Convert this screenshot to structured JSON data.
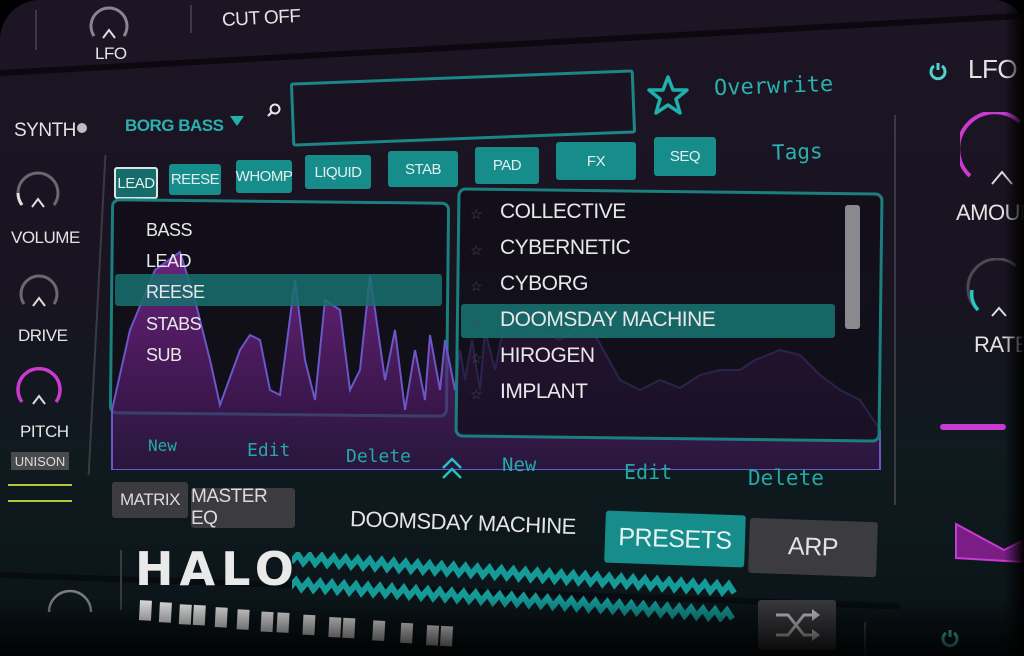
{
  "top": {
    "lfo_knob_label": "LFO",
    "cutoff_label": "CUT OFF"
  },
  "left_panel": {
    "section_label": "SYNTH",
    "knobs": [
      {
        "label": "VOLUME",
        "value": 0.15,
        "color": "#cfcfcf"
      },
      {
        "label": "DRIVE",
        "value": 0.0,
        "color": "#cfcfcf"
      },
      {
        "label": "PITCH",
        "value": 1.0,
        "color": "#c93ad0"
      }
    ],
    "unison_label": "UNISON"
  },
  "browser": {
    "bank_name": "BORG BASS",
    "search": {
      "value": "",
      "placeholder": ""
    },
    "favorite_icon": "star-outline-icon",
    "overwrite_label": "Overwrite",
    "tags_label": "Tags",
    "tags": [
      {
        "label": "LEAD",
        "active": true
      },
      {
        "label": "REESE",
        "active": false
      },
      {
        "label": "WHOMP",
        "active": false
      },
      {
        "label": "LIQUID",
        "active": false
      },
      {
        "label": "STAB",
        "active": false
      },
      {
        "label": "PAD",
        "active": false
      },
      {
        "label": "FX",
        "active": false
      },
      {
        "label": "SEQ",
        "active": false
      }
    ],
    "categories": [
      {
        "label": "BASS",
        "selected": false
      },
      {
        "label": "LEAD",
        "selected": false
      },
      {
        "label": "REESE",
        "selected": true
      },
      {
        "label": "STABS",
        "selected": false
      },
      {
        "label": "SUB",
        "selected": false
      }
    ],
    "presets": [
      {
        "label": "COLLECTIVE",
        "selected": false
      },
      {
        "label": "CYBERNETIC",
        "selected": false
      },
      {
        "label": "CYBORG",
        "selected": false
      },
      {
        "label": "DOOMSDAY MACHINE",
        "selected": true
      },
      {
        "label": "HIROGEN",
        "selected": false
      },
      {
        "label": "IMPLANT",
        "selected": false
      }
    ],
    "category_actions": {
      "new": "New",
      "edit": "Edit",
      "delete": "Delete"
    },
    "preset_actions": {
      "new": "New",
      "edit": "Edit",
      "delete": "Delete"
    }
  },
  "bottom_bar": {
    "matrix_label": "MATRIX",
    "master_eq_label": "MASTER EQ",
    "current_preset": "DOOMSDAY MACHINE",
    "presets_tab": "PRESETS",
    "arp_tab": "ARP",
    "logo_text": "HALO"
  },
  "right_panel": {
    "title": "LFO",
    "knobs": [
      {
        "label": "AMOUNT",
        "value": 0.7,
        "color": "#c93ad0"
      },
      {
        "label": "RATE",
        "value": 0.25,
        "color": "#29c6c4"
      }
    ]
  },
  "colors": {
    "accent_teal": "#178d8b",
    "accent_magenta": "#c93ad0",
    "text_teal": "#2ab0ae"
  }
}
